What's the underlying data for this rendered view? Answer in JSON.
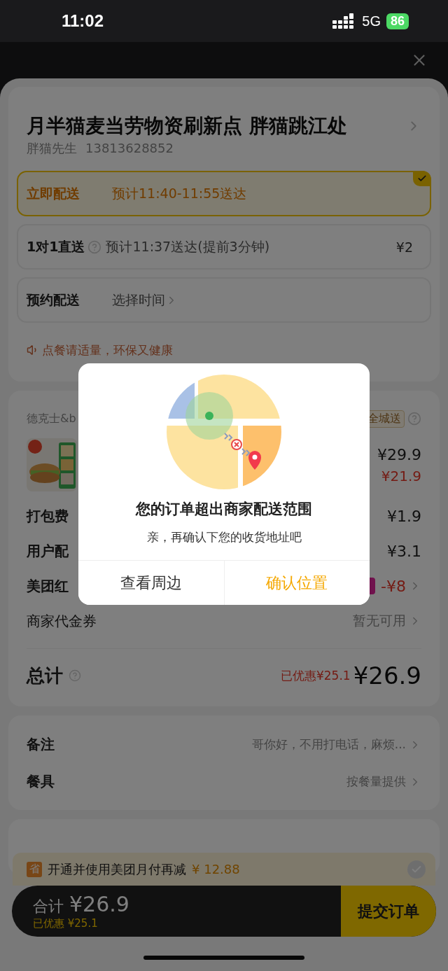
{
  "status_bar": {
    "time": "11:02",
    "network": "5G",
    "battery": "86"
  },
  "address": {
    "title": "月半猫麦当劳物资刷新点 胖猫跳江处",
    "contact": "胖猫先生",
    "phone": "13813628852"
  },
  "delivery_options": [
    {
      "label": "立即配送",
      "desc": "预计11:40-11:55送达",
      "selected": true,
      "help": false,
      "chevron": false
    },
    {
      "label": "1对1直送",
      "desc": "预计11:37送达(提前3分钟)",
      "price": "¥2",
      "selected": false,
      "help": true,
      "chevron": false
    },
    {
      "label": "预约配送",
      "desc": "选择时间",
      "selected": false,
      "help": false,
      "chevron": true
    }
  ],
  "tip": "点餐请适量，环保又健康",
  "store": {
    "name": "德克士&b",
    "tag": "全城送"
  },
  "product": {
    "original_price": "¥29.9",
    "price": "¥21.9"
  },
  "fees": [
    {
      "label": "打包费",
      "value": "¥1.9",
      "kind": "plain"
    },
    {
      "label": "用户配",
      "value": "¥3.1",
      "kind": "plain"
    },
    {
      "label": "美团红",
      "value": "-¥8",
      "kind": "discount"
    },
    {
      "label": "商家代金券",
      "value": "暂无可用",
      "kind": "link"
    }
  ],
  "total": {
    "label": "总计",
    "saved": "已优惠¥25.1",
    "amount": "¥26.9"
  },
  "extras": [
    {
      "label": "备注",
      "value": "哥你好，不用打电话，麻烦..."
    },
    {
      "label": "餐具",
      "value": "按餐量提供"
    }
  ],
  "promo": {
    "icon": "省",
    "text": "开通并使用美团月付再减",
    "amount": "¥ 12.88",
    "checked": false
  },
  "checkout": {
    "label": "合计",
    "amount": "¥26.9",
    "saved": "已优惠 ¥25.1",
    "button": "提交订单"
  },
  "dialog": {
    "title": "您的订单超出商家配送范围",
    "message": "亲，再确认下您的收货地址吧",
    "buttons": [
      {
        "label": "查看周边",
        "kind": "secondary"
      },
      {
        "label": "确认位置",
        "kind": "primary"
      }
    ]
  }
}
